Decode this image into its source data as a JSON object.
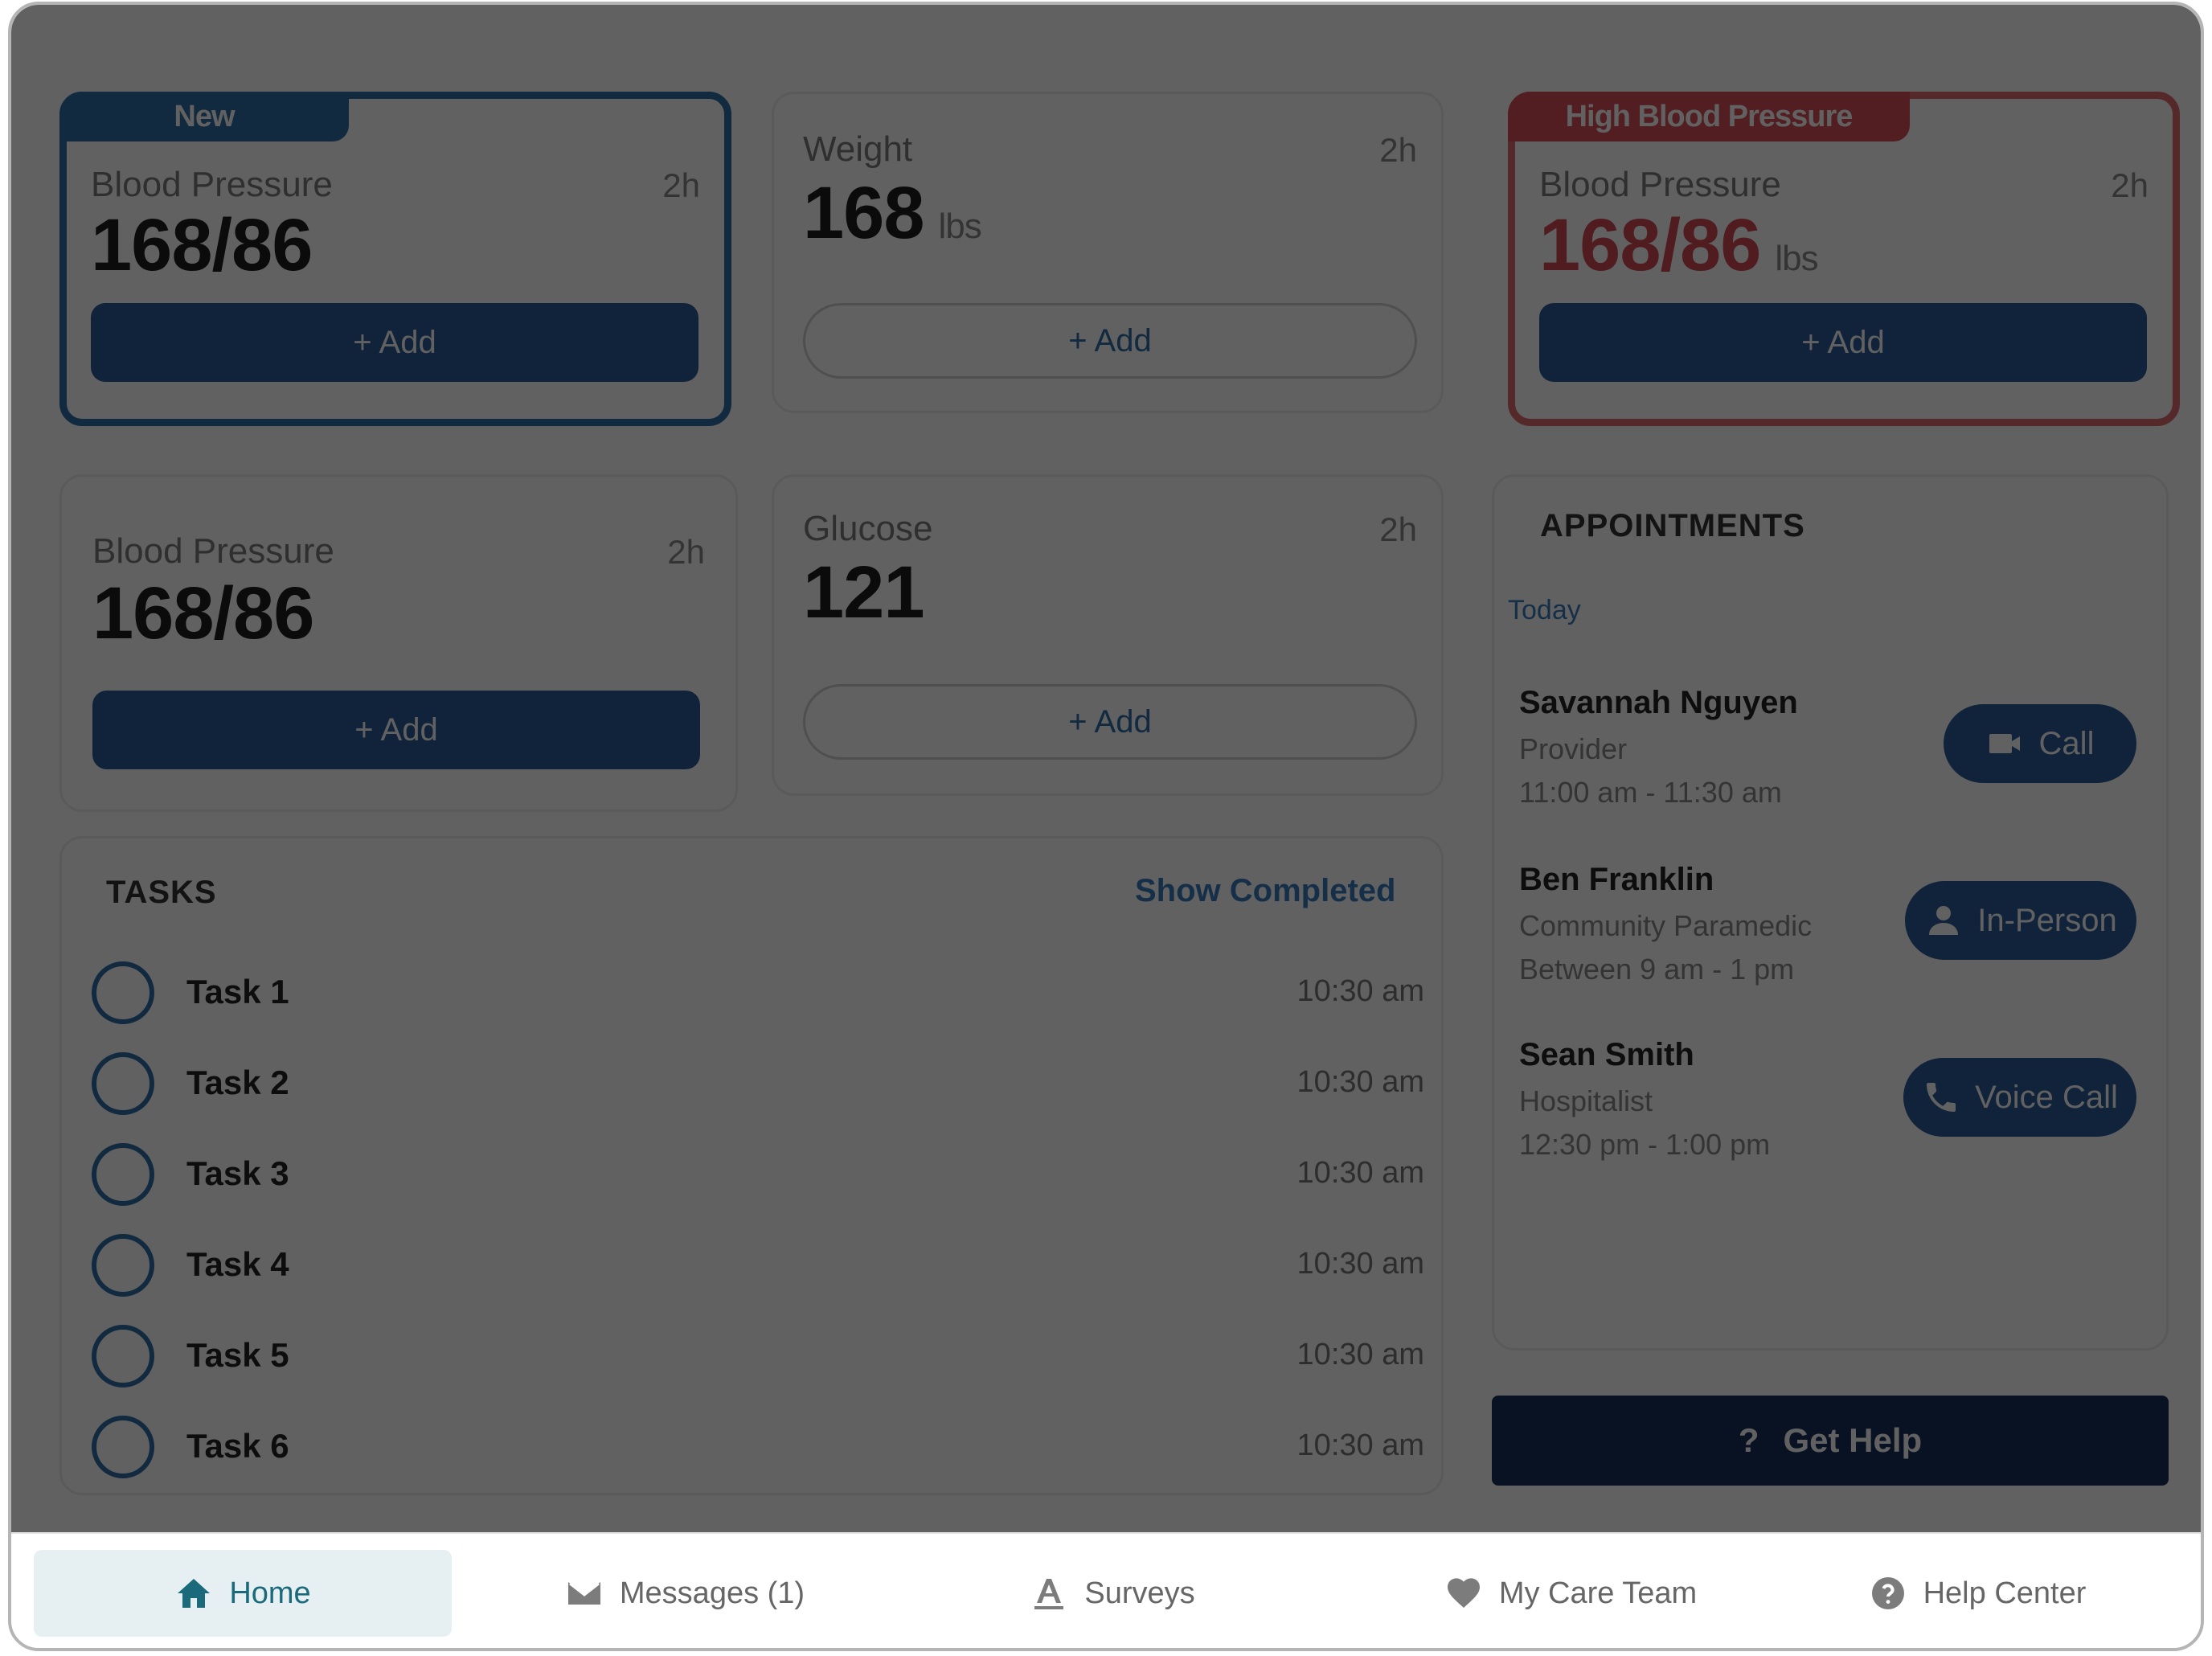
{
  "metrics": {
    "card1": {
      "badge": "New",
      "label": "Blood Pressure",
      "time": "2h",
      "value": "168/86",
      "unit": "",
      "button": "+ Add"
    },
    "card2": {
      "label": "Weight",
      "time": "2h",
      "value": "168",
      "unit": "lbs",
      "button": "+ Add"
    },
    "card3": {
      "badge": "High Blood Pressure",
      "label": "Blood Pressure",
      "time": "2h",
      "value": "168/86",
      "unit": "lbs",
      "button": "+ Add"
    },
    "card4": {
      "label": "Blood Pressure",
      "time": "2h",
      "value": "168/86",
      "button": "+ Add"
    },
    "card5": {
      "label": "Glucose",
      "time": "2h",
      "value": "121",
      "button": "+ Add"
    }
  },
  "tasks": {
    "title": "TASKS",
    "show_completed": "Show Completed",
    "items": [
      {
        "name": "Task 1",
        "time": "10:30 am"
      },
      {
        "name": "Task 2",
        "time": "10:30 am"
      },
      {
        "name": "Task 3",
        "time": "10:30 am"
      },
      {
        "name": "Task 4",
        "time": "10:30 am"
      },
      {
        "name": "Task 5",
        "time": "10:30 am"
      },
      {
        "name": "Task 6",
        "time": "10:30 am"
      }
    ]
  },
  "appointments": {
    "title": "APPOINTMENTS",
    "day": "Today",
    "items": [
      {
        "name": "Savannah Nguyen",
        "role": "Provider",
        "time": "11:00 am - 11:30 am",
        "button": "Call",
        "icon": "video-icon"
      },
      {
        "name": "Ben Franklin",
        "role": "Community Paramedic",
        "time": "Between 9 am - 1 pm",
        "button": "In-Person",
        "icon": "person-icon"
      },
      {
        "name": "Sean Smith",
        "role": "Hospitalist",
        "time": "12:30 pm - 1:00 pm",
        "button": "Voice Call",
        "icon": "phone-icon"
      }
    ]
  },
  "get_help": {
    "icon": "?",
    "label": "Get Help"
  },
  "tabbar": {
    "items": [
      {
        "label": "Home",
        "icon": "home-icon",
        "active": true
      },
      {
        "label": "Messages (1)",
        "icon": "envelope-icon"
      },
      {
        "label": "Surveys",
        "icon": "survey-icon"
      },
      {
        "label": "My Care Team",
        "icon": "heart-icon"
      },
      {
        "label": "Help Center",
        "icon": "question-circle-icon"
      }
    ]
  },
  "colors": {
    "primary": "#2b5d98",
    "alert": "#d74f58",
    "active_tab": "#1b6a7c"
  }
}
